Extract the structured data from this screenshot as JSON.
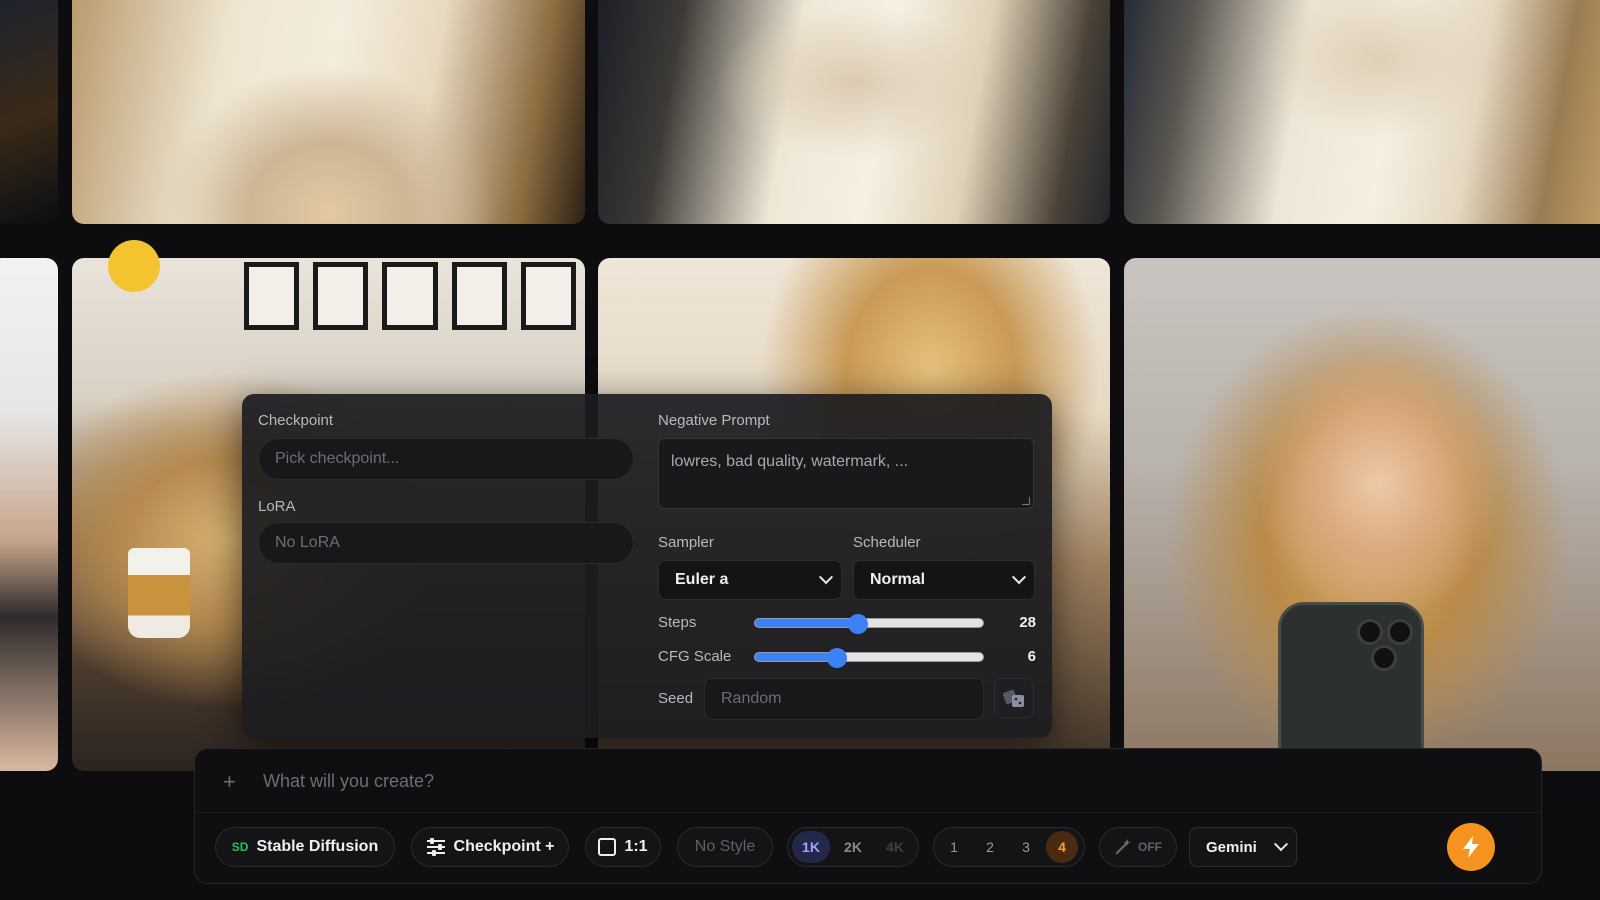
{
  "settings_panel": {
    "checkpoint": {
      "label": "Checkpoint",
      "placeholder": "Pick checkpoint..."
    },
    "lora": {
      "label": "LoRA",
      "placeholder": "No LoRA"
    },
    "negative_prompt": {
      "label": "Negative Prompt",
      "placeholder": "lowres, bad quality, watermark, ..."
    },
    "sampler": {
      "label": "Sampler",
      "value": "Euler a"
    },
    "scheduler": {
      "label": "Scheduler",
      "value": "Normal"
    },
    "steps": {
      "label": "Steps",
      "value": "28",
      "fraction": 0.45
    },
    "cfg_scale": {
      "label": "CFG Scale",
      "value": "6",
      "fraction": 0.36
    },
    "seed": {
      "label": "Seed",
      "placeholder": "Random"
    }
  },
  "prompt_bar": {
    "placeholder": "What will you create?",
    "model_badge": "SD",
    "model": "Stable Diffusion",
    "checkpoint_button": "Checkpoint +",
    "aspect_ratio": "1:1",
    "style": "No Style",
    "resolutions": [
      "1K",
      "2K",
      "4K"
    ],
    "selected_resolution": "1K",
    "counts": [
      "1",
      "2",
      "3",
      "4"
    ],
    "selected_count": "4",
    "enhance_toggle": "OFF",
    "llm_select": "Gemini"
  },
  "colors": {
    "accent_blue": "#3b82f6",
    "generate_orange": "#f59321",
    "badge_green": "#22c55e"
  },
  "icons": [
    "plus-icon",
    "sd-badge",
    "sliders-icon",
    "square-icon",
    "magic-wand-icon",
    "chevron-down-icon",
    "dice-icon",
    "lightning-icon"
  ]
}
